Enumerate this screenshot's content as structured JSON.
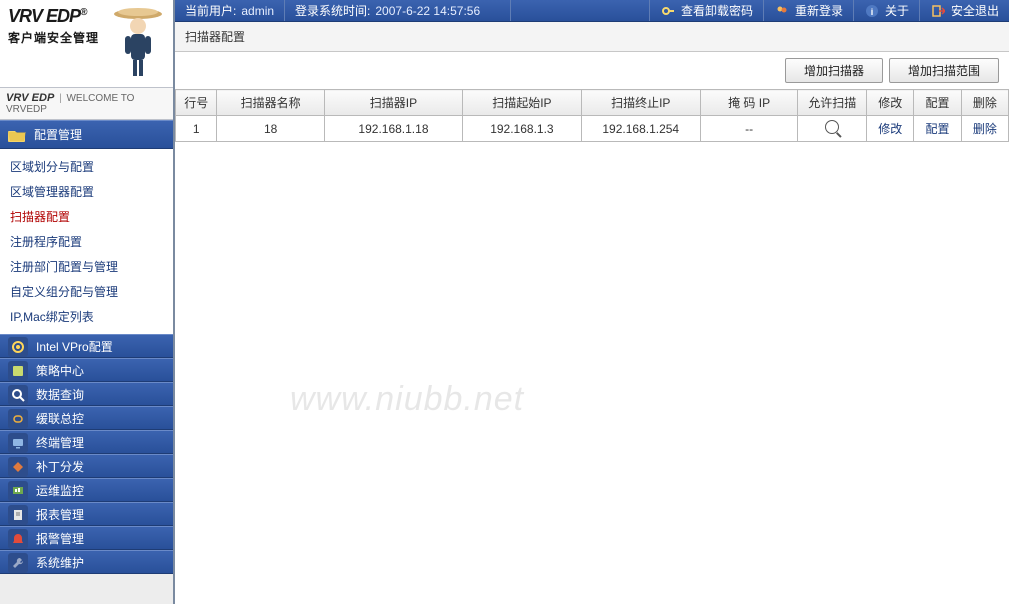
{
  "brand": {
    "title": "VRV EDP",
    "reg": "®",
    "subtitle": "客户端安全管理",
    "welcome_prefix": "VRV EDP",
    "welcome_text": "WELCOME TO VRVEDP"
  },
  "topbar": {
    "user_label": "当前用户:",
    "user_value": "admin",
    "login_label": "登录系统时间:",
    "login_value": "2007-6-22 14:57:56",
    "view_pwd": "查看卸载密码",
    "relogin": "重新登录",
    "about": "关于",
    "exit": "安全退出"
  },
  "page": {
    "title": "扫描器配置"
  },
  "actions": {
    "add_scanner": "增加扫描器",
    "add_range": "增加扫描范围"
  },
  "sidebar": {
    "config_header": "配置管理",
    "links": [
      {
        "label": "区域划分与配置"
      },
      {
        "label": "区域管理器配置"
      },
      {
        "label": "扫描器配置",
        "selected": true
      },
      {
        "label": "注册程序配置"
      },
      {
        "label": "注册部门配置与管理"
      },
      {
        "label": "自定义组分配与管理"
      },
      {
        "label": "IP,Mac绑定列表"
      }
    ],
    "modules": [
      {
        "label": "Intel VPro配置"
      },
      {
        "label": "策略中心"
      },
      {
        "label": "数据查询"
      },
      {
        "label": "缓联总控"
      },
      {
        "label": "终端管理"
      },
      {
        "label": "补丁分发"
      },
      {
        "label": "运维监控"
      },
      {
        "label": "报表管理"
      },
      {
        "label": "报警管理"
      },
      {
        "label": "系统维护"
      }
    ]
  },
  "table": {
    "headers": {
      "row_no": "行号",
      "name": "扫描器名称",
      "ip": "扫描器IP",
      "start_ip": "扫描起始IP",
      "end_ip": "扫描终止IP",
      "mask_ip": "掩 码 IP",
      "allow": "允许扫描",
      "edit": "修改",
      "config": "配置",
      "delete": "删除"
    },
    "rows": [
      {
        "row_no": "1",
        "name": "18",
        "ip": "192.168.1.18",
        "start_ip": "192.168.1.3",
        "end_ip": "192.168.1.254",
        "mask_ip": "--",
        "edit": "修改",
        "config": "配置",
        "delete": "删除"
      }
    ]
  },
  "watermark": "www.niubb.net"
}
